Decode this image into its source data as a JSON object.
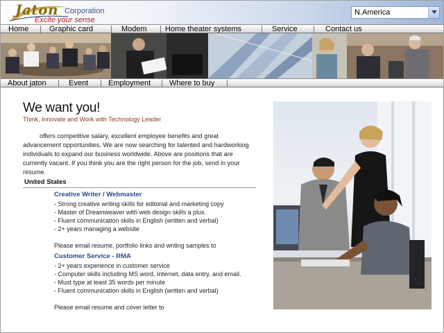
{
  "brand": {
    "name": "Jaton",
    "suffix": "Corporation",
    "tagline": "Excite your sense"
  },
  "region_select": {
    "value": "N.America"
  },
  "main_nav": [
    {
      "label": "Home"
    },
    {
      "label": "Graphic card"
    },
    {
      "label": "Modem"
    },
    {
      "label": "Home theater systems"
    },
    {
      "label": "Service"
    },
    {
      "label": "Contact us"
    }
  ],
  "sub_nav": [
    {
      "label": "About jaton"
    },
    {
      "label": "Event"
    },
    {
      "label": "Employment"
    },
    {
      "label": "Where to buy"
    }
  ],
  "content": {
    "title": "We want you!",
    "tagline": "Think, Innovate and Work with Technology Leader",
    "intro": "offers competitive salary, excellent employee benefits and great advancement opportunities. We are now searching for talented and hardworking individuals to expand our business worldwide. Above are positions that are currently vacant. If you think you are the right person for the job, send in your resume.",
    "section": "United States",
    "jobs": [
      {
        "title": "Creative Writer / Webmaster",
        "requirements": [
          "- Strong creative writing skills for editorial and marketing copy",
          "- Master of Dreamweaver with web design skills a plus.",
          "- Fluent communication skills in English (written and verbal)",
          "- 2+ years managing a website"
        ],
        "email_note": "Please email resume, portfolio links and writing samples to"
      },
      {
        "title": "Customer Service  -  RMA",
        "requirements": [
          "- 2+ years experience in customer service",
          "- Computer skills including MS word, Internet, data entry, and email.",
          "- Must type at least 35 words per minute",
          "- Fluent communication skills in English (written and verbal)"
        ],
        "email_note": "Please email resume and cover letter to"
      }
    ]
  },
  "colors": {
    "brand_gold": "#8a6d10",
    "brand_blue": "#3b4f86",
    "tagline_red": "#b0201d",
    "job_title_blue": "#2a4b8d",
    "content_tagline": "#8b3a1e"
  },
  "icons": {
    "select_arrow": "chevron-down-icon",
    "logo_mark": "swoosh-icon"
  }
}
